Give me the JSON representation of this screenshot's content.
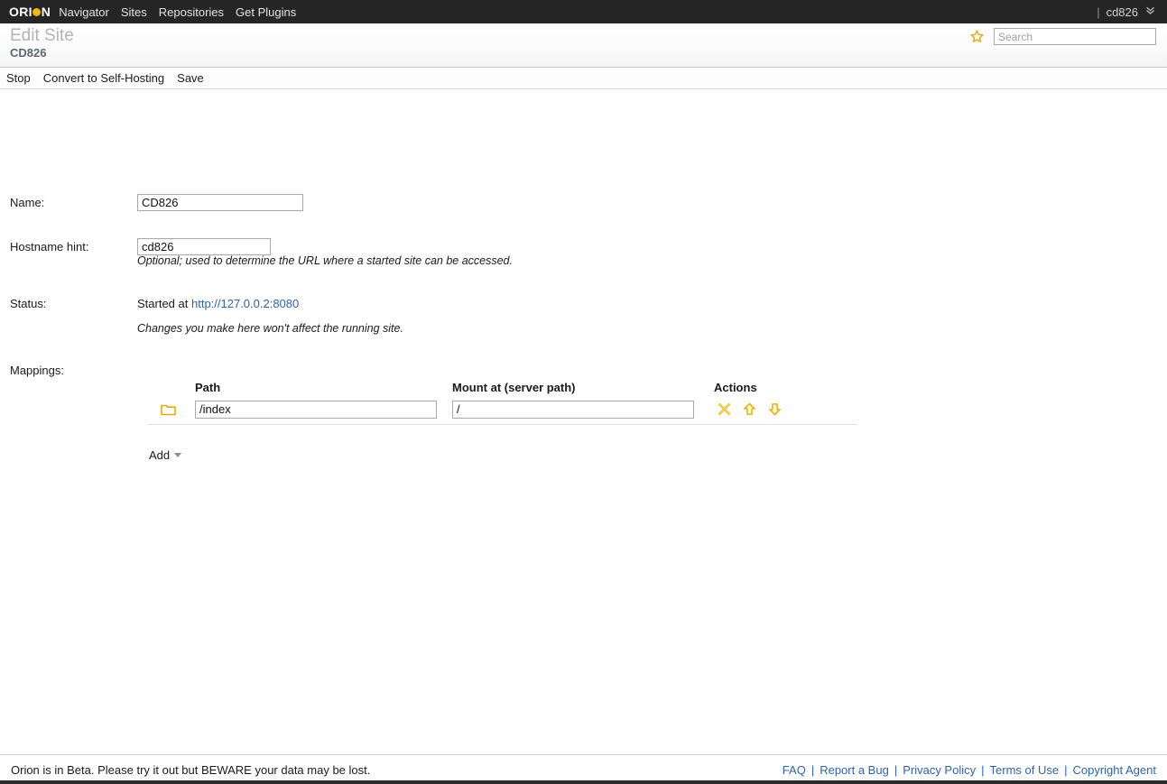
{
  "topbar": {
    "logo_text": "ORI",
    "logo_text_tail": "N",
    "logo_icon": "orion-dot-logo",
    "nav": [
      {
        "label": "Navigator",
        "name": "nav-navigator"
      },
      {
        "label": "Sites",
        "name": "nav-sites"
      },
      {
        "label": "Repositories",
        "name": "nav-repositories"
      },
      {
        "label": "Get Plugins",
        "name": "nav-get-plugins"
      }
    ],
    "separator": "|",
    "user": "cd826",
    "chevron": "»"
  },
  "title": {
    "page_title": "Edit Site",
    "page_subtitle": "CD826",
    "star_icon": "favorite-star-icon"
  },
  "search": {
    "placeholder": "Search",
    "value": ""
  },
  "toolbar": {
    "commands": [
      {
        "label": "Stop",
        "name": "stop-button"
      },
      {
        "label": "Convert to Self-Hosting",
        "name": "convert-to-self-hosting-button"
      },
      {
        "label": "Save",
        "name": "save-button"
      }
    ]
  },
  "form": {
    "name_label": "Name:",
    "name_value": "CD826",
    "hostname_label": "Hostname hint:",
    "hostname_value": "cd826",
    "hostname_hint": "Optional; used to determine the URL where a started site can be accessed.",
    "status_label": "Status:",
    "status_prefix": "Started at ",
    "status_link": "http://127.0.0.2:8080",
    "status_note": "Changes you make here won't affect the running site.",
    "mappings_label": "Mappings:"
  },
  "mappings": {
    "headers": {
      "path": "Path",
      "mount": "Mount at (server path)",
      "actions": "Actions"
    },
    "rows": [
      {
        "folder_icon": "folder-icon",
        "path": "/index",
        "mount": "/",
        "actions": [
          "delete-icon",
          "move-up-icon",
          "move-down-icon"
        ]
      }
    ],
    "add_label": "Add"
  },
  "footer": {
    "notice": "Orion is in Beta. Please try it out but BEWARE your data may be lost.",
    "links": [
      {
        "label": "FAQ",
        "name": "footer-link-faq"
      },
      {
        "label": "Report a Bug",
        "name": "footer-link-report-a-bug"
      },
      {
        "label": "Privacy Policy",
        "name": "footer-link-privacy-policy"
      },
      {
        "label": "Terms of Use",
        "name": "footer-link-terms-of-use"
      },
      {
        "label": "Copyright Agent",
        "name": "footer-link-copyright-agent"
      }
    ],
    "separator": "|"
  },
  "colors": {
    "topbar_bg": "#252525",
    "accent_gold": "#f5b80a",
    "link_blue": "#2a63b5",
    "subtitle_slate": "#5b6670"
  }
}
